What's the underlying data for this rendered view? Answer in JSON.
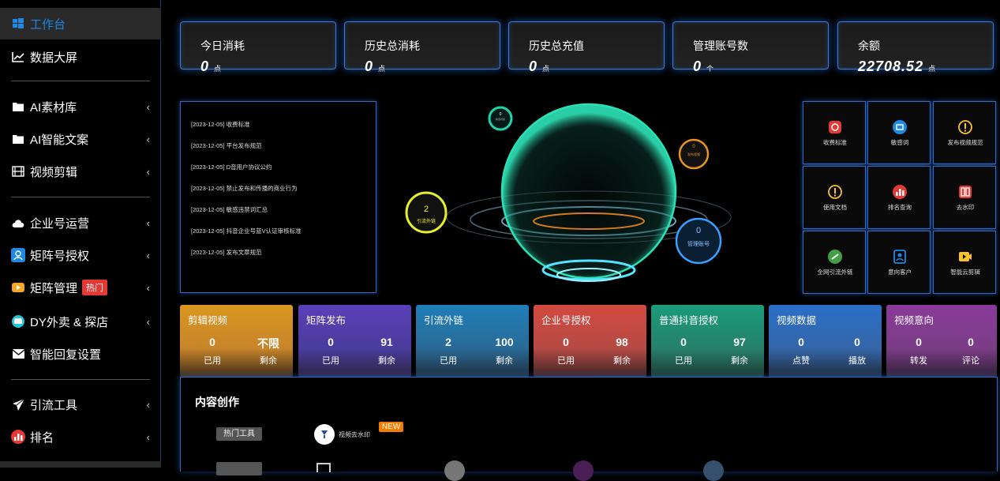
{
  "sidebar": {
    "items": [
      {
        "label": "工作台",
        "icon": "windows-icon"
      },
      {
        "label": "数据大屏",
        "icon": "line-chart-icon"
      },
      {
        "label": "AI素材库",
        "icon": "folder-icon"
      },
      {
        "label": "AI智能文案",
        "icon": "folder-icon"
      },
      {
        "label": "视频剪辑",
        "icon": "film-icon"
      },
      {
        "label": "企业号运营",
        "icon": "cloud-icon"
      },
      {
        "label": "矩阵号授权",
        "icon": "user-card-icon"
      },
      {
        "label": "矩阵管理",
        "icon": "play-icon",
        "badge": "热门"
      },
      {
        "label": "DY外卖 & 探店",
        "icon": "store-icon"
      },
      {
        "label": "智能回复设置",
        "icon": "mail-icon"
      },
      {
        "label": "引流工具",
        "icon": "send-icon"
      },
      {
        "label": "排名",
        "icon": "rank-icon"
      }
    ],
    "chevron": "‹"
  },
  "stats": [
    {
      "label": "今日消耗",
      "value": "0",
      "unit": "点"
    },
    {
      "label": "历史总消耗",
      "value": "0",
      "unit": "点"
    },
    {
      "label": "历史总充值",
      "value": "0",
      "unit": "点"
    },
    {
      "label": "管理账号数",
      "value": "0",
      "unit": "个"
    },
    {
      "label": "余额",
      "value": "22708.52",
      "unit": "点"
    }
  ],
  "notices": [
    "[2023-12-05] 收费标准",
    "[2023-12-05] 平台发布规范",
    "[2023-12-05] D音用户协议公约",
    "[2023-12-05] 禁止发布和传播的商业行为",
    "[2023-12-05] 敏感违禁词汇总",
    "[2023-12-05] 抖音企业号蓝V认证审核标准",
    "[2023-12-05] 发布文章规范"
  ],
  "orbits": {
    "teal": {
      "value": "0",
      "label": "精选视频"
    },
    "orange": {
      "value": "0",
      "label": "发布视频"
    },
    "yellow": {
      "value": "2",
      "label": "引流外链"
    },
    "blue": {
      "value": "0",
      "label": "管理账号"
    }
  },
  "tiles": [
    {
      "label": "收费标准",
      "icon": "fee-icon",
      "color": "#e53935"
    },
    {
      "label": "敏感词",
      "icon": "sensitive-word-icon",
      "color": "#1e88e5"
    },
    {
      "label": "发布视频规范",
      "icon": "warning-icon",
      "color": "#fbc02d"
    },
    {
      "label": "使用文档",
      "icon": "warning-icon",
      "color": "#fbc02d"
    },
    {
      "label": "排名查询",
      "icon": "rank-query-icon",
      "color": "#e53935"
    },
    {
      "label": "去水印",
      "icon": "stamp-icon",
      "color": "#e53935"
    },
    {
      "label": "全网引流外链",
      "icon": "link-icon",
      "color": "#43a047"
    },
    {
      "label": "意向客户",
      "icon": "contact-book-icon",
      "color": "#1e88e5"
    },
    {
      "label": "智能云剪辑",
      "icon": "video-icon",
      "color": "#fbc02d"
    }
  ],
  "cards": [
    {
      "title": "剪辑视频",
      "v1": "0",
      "l1": "已用",
      "v2": "不限",
      "l2": "剩余",
      "color": "#d9971f"
    },
    {
      "title": "矩阵发布",
      "v1": "0",
      "l1": "已用",
      "v2": "91",
      "l2": "剩余",
      "color": "#5b3fb8"
    },
    {
      "title": "引流外链",
      "v1": "2",
      "l1": "已用",
      "v2": "100",
      "l2": "剩余",
      "color": "#1f7fb8"
    },
    {
      "title": "企业号授权",
      "v1": "0",
      "l1": "已用",
      "v2": "98",
      "l2": "剩余",
      "color": "#d24a40"
    },
    {
      "title": "普通抖音授权",
      "v1": "0",
      "l1": "已用",
      "v2": "97",
      "l2": "剩余",
      "color": "#1a9c7a"
    },
    {
      "title": "视频数据",
      "v1": "0",
      "l1": "点赞",
      "v2": "0",
      "l2": "播放",
      "color": "#2a6fc8"
    },
    {
      "title": "视频意向",
      "v1": "0",
      "l1": "转发",
      "v2": "0",
      "l2": "评论",
      "color": "#8a3a9a"
    }
  ],
  "content": {
    "title": "内容创作",
    "hot_tag": "热门工具",
    "tool_label": "视频去水印",
    "new_badge": "NEW"
  }
}
